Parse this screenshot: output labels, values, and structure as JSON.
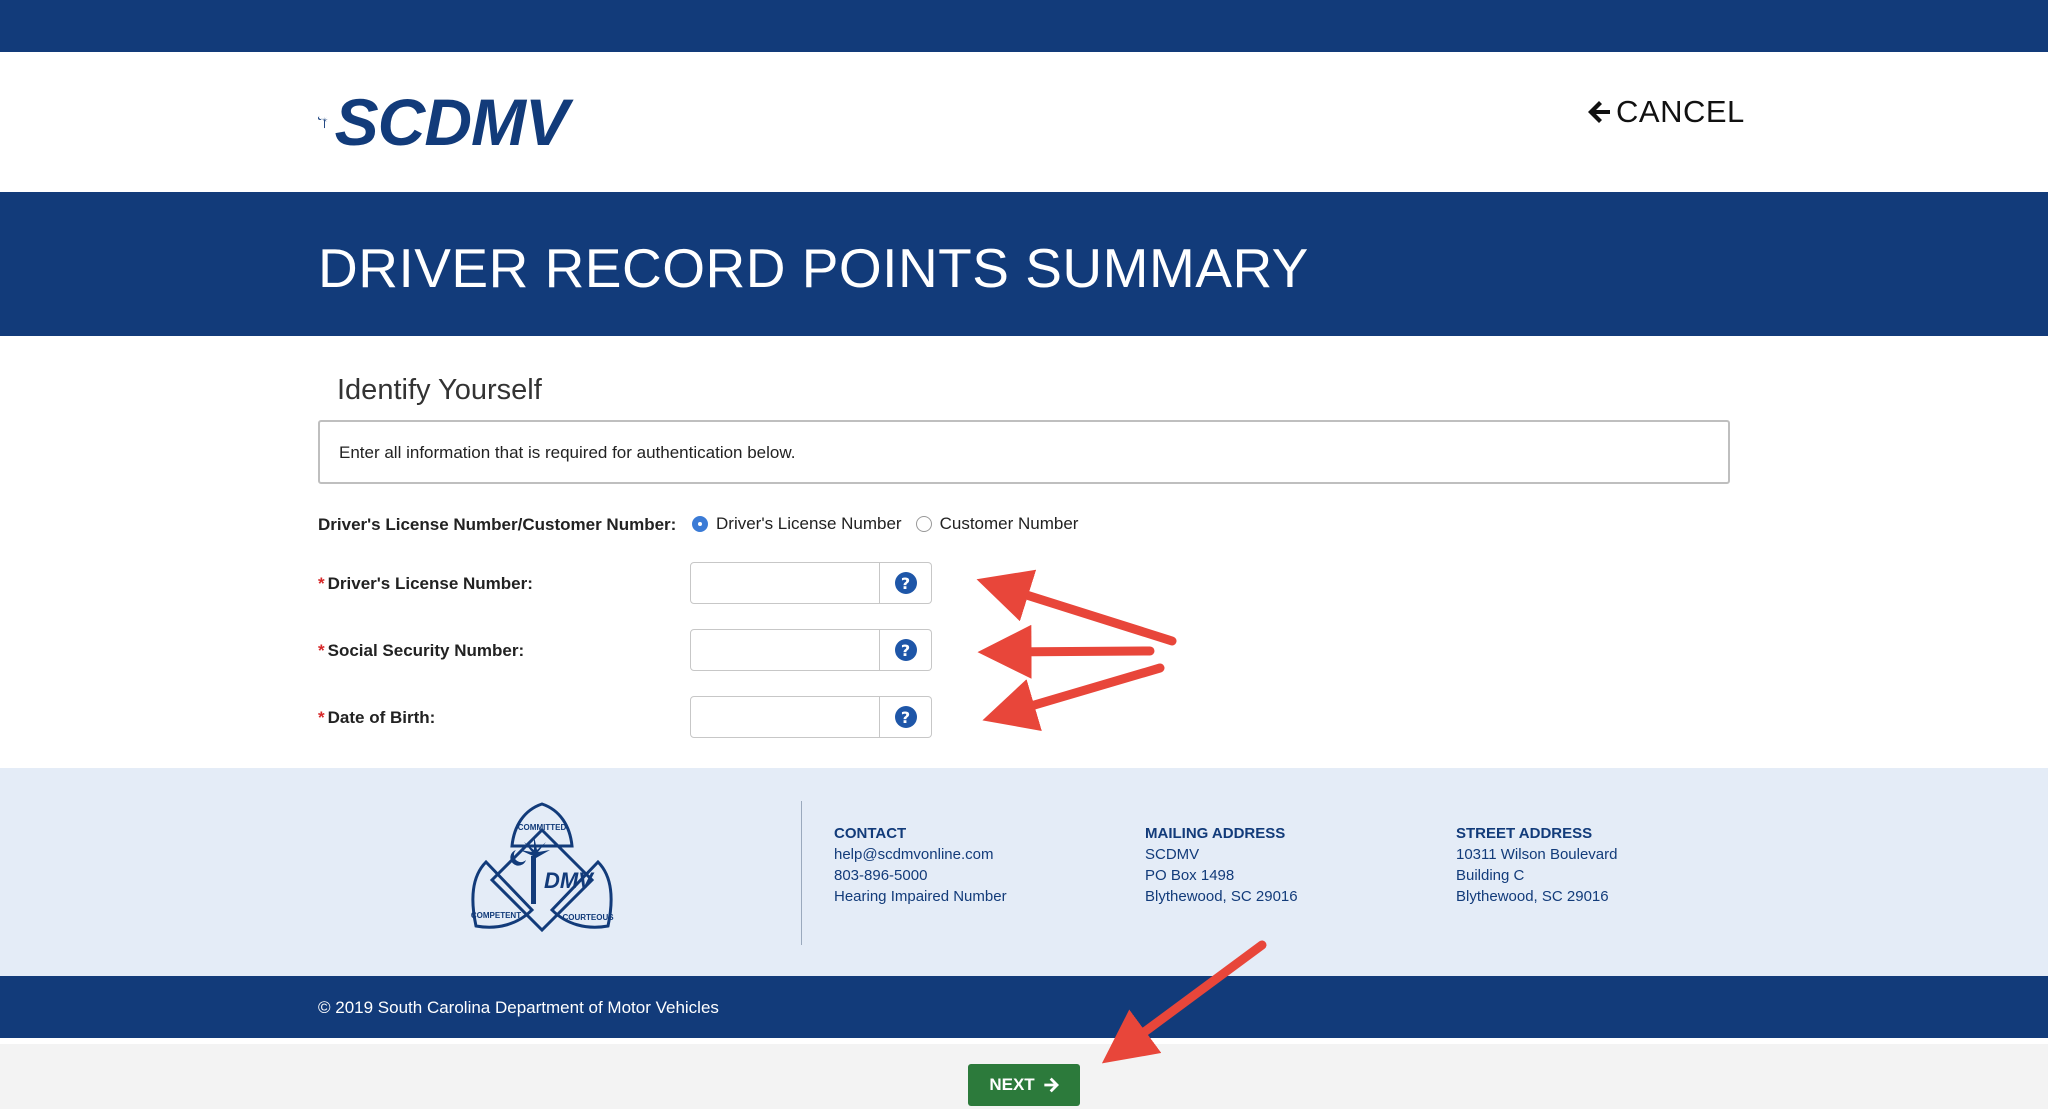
{
  "header": {
    "logo_text": "SCDMV",
    "cancel_label": "CANCEL"
  },
  "banner": {
    "title": "DRIVER RECORD POINTS SUMMARY"
  },
  "form": {
    "section_title": "Identify Yourself",
    "info_text": "Enter all information that is required for authentication below.",
    "id_type_label": "Driver's License Number/Customer Number:",
    "id_type_options": [
      {
        "label": "Driver's License Number",
        "selected": true
      },
      {
        "label": "Customer Number",
        "selected": false
      }
    ],
    "fields": [
      {
        "label": "Driver's License Number:",
        "required": true,
        "value": ""
      },
      {
        "label": "Social Security Number:",
        "required": true,
        "value": ""
      },
      {
        "label": "Date of Birth:",
        "required": true,
        "value": ""
      }
    ],
    "required_marker": "*",
    "help_glyph": "?"
  },
  "footer": {
    "logo": {
      "center": "DMV",
      "top": "COMMITTED",
      "left": "COMPETENT",
      "right": "COURTEOUS"
    },
    "contact": {
      "heading": "CONTACT",
      "lines": [
        "help@scdmvonline.com",
        "803-896-5000",
        "Hearing Impaired Number"
      ]
    },
    "mailing": {
      "heading": "MAILING ADDRESS",
      "lines": [
        "SCDMV",
        "PO Box 1498",
        "Blythewood, SC 29016"
      ]
    },
    "street": {
      "heading": "STREET ADDRESS",
      "lines": [
        "10311 Wilson Boulevard",
        "Building C",
        "Blythewood, SC 29016"
      ]
    },
    "copyright": "© 2019 South Carolina Department of Motor Vehicles"
  },
  "actions": {
    "next_label": "NEXT"
  },
  "colors": {
    "brand_navy": "#123b7a",
    "footer_bg": "#e4ecf7",
    "next_green": "#2c7a3b",
    "required_red": "#d62728",
    "annotation_arrow": "#e8463a"
  },
  "icons": [
    "palmetto-moon-logo",
    "arrow-left-icon",
    "help-icon",
    "arrow-right-icon"
  ]
}
